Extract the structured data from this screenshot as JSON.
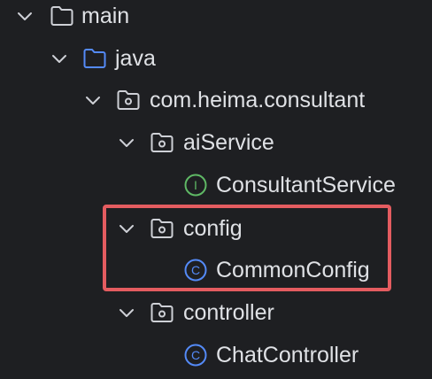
{
  "tree": {
    "nodes": [
      {
        "label": "main",
        "kind": "folder",
        "expanded": true,
        "icon": "folder-icon"
      },
      {
        "label": "java",
        "kind": "source-root",
        "expanded": true,
        "icon": "source-folder-icon"
      },
      {
        "label": "com.heima.consultant",
        "kind": "package",
        "expanded": true,
        "icon": "package-icon"
      },
      {
        "label": "aiService",
        "kind": "package",
        "expanded": true,
        "icon": "package-icon"
      },
      {
        "label": "ConsultantService",
        "kind": "interface",
        "icon": "interface-icon",
        "glyph": "I"
      },
      {
        "label": "config",
        "kind": "package",
        "expanded": true,
        "icon": "package-icon"
      },
      {
        "label": "CommonConfig",
        "kind": "class",
        "icon": "class-icon",
        "glyph": "C"
      },
      {
        "label": "controller",
        "kind": "package",
        "expanded": true,
        "icon": "package-icon"
      },
      {
        "label": "ChatController",
        "kind": "class",
        "icon": "class-icon",
        "glyph": "C"
      }
    ]
  },
  "colors": {
    "background": "#1e1f22",
    "text": "#dfe1e5",
    "folder": "#ced0d6",
    "source_folder": "#548af7",
    "interface": "#5fb865",
    "class": "#548af7",
    "highlight": "#e45c60"
  }
}
